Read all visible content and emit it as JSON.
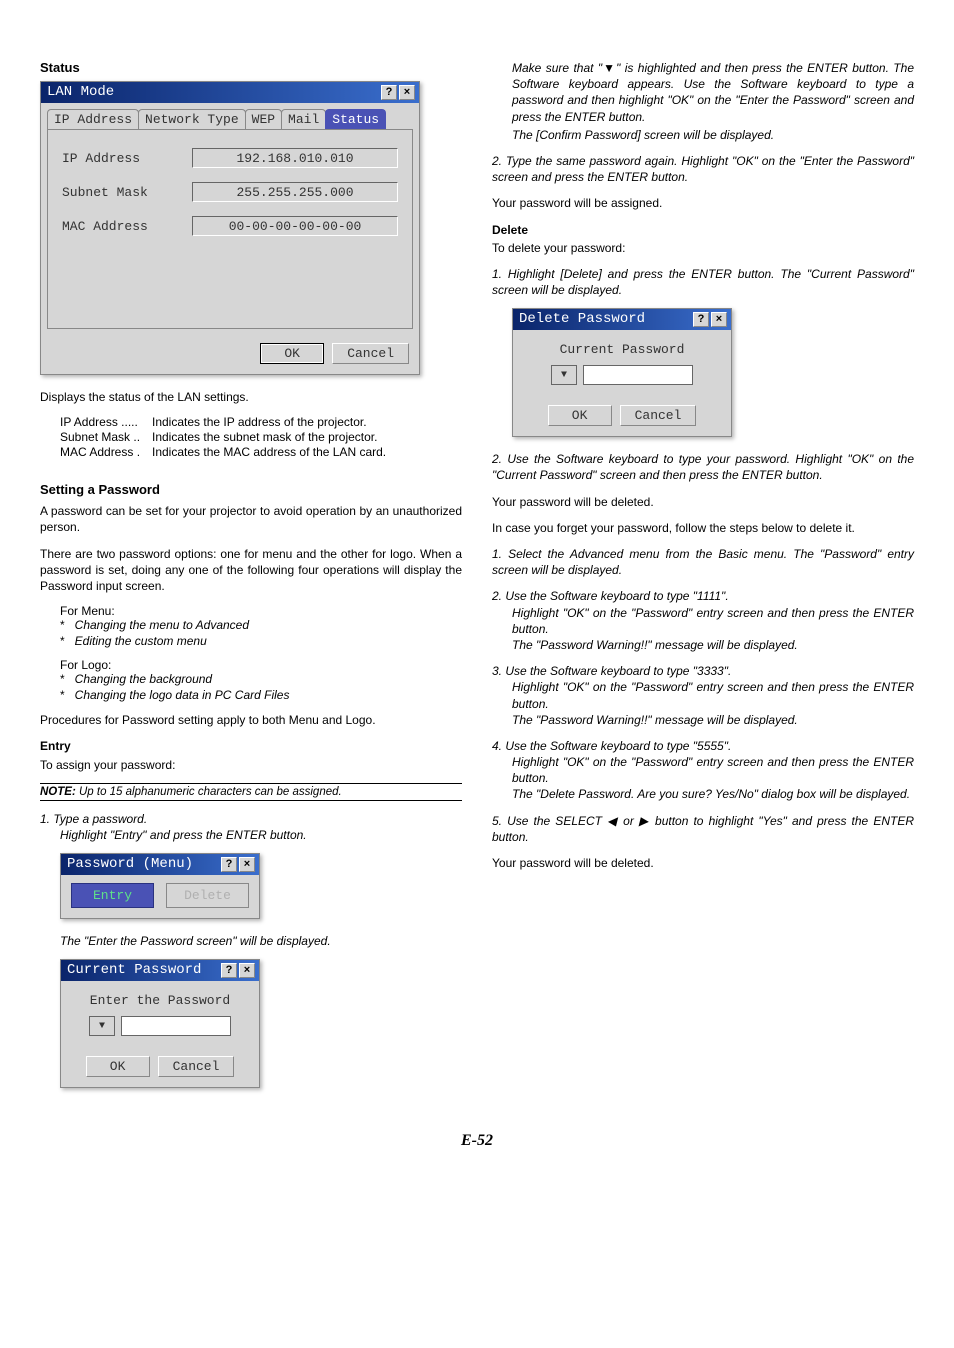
{
  "page_number": "E-52",
  "left": {
    "status_heading": "Status",
    "lan_dialog": {
      "title": "LAN Mode",
      "help_btn": "?",
      "close_btn": "×",
      "tabs": [
        "IP Address",
        "Network Type",
        "WEP",
        "Mail",
        "Status"
      ],
      "active_tab": "Status",
      "fields": {
        "ip_label": "IP Address",
        "ip_value": "192.168.010.010",
        "subnet_label": "Subnet Mask",
        "subnet_value": "255.255.255.000",
        "mac_label": "MAC Address",
        "mac_value": "00-00-00-00-00-00"
      },
      "ok": "OK",
      "cancel": "Cancel"
    },
    "status_desc": "Displays the status of the LAN settings.",
    "dl": [
      {
        "term": "IP Address",
        "dots": ".....",
        "def": "Indicates the IP address of the projector."
      },
      {
        "term": "Subnet Mask",
        "dots": "..",
        "def": "Indicates the subnet mask of the projector."
      },
      {
        "term": "MAC Address",
        "dots": ".",
        "def": "Indicates the MAC address of the LAN card."
      }
    ],
    "setting_heading": "Setting a Password",
    "setting_p1": "A password can be set for your projector to avoid operation by an unauthorized person.",
    "setting_p2": "There are two password options: one for menu and the other for logo. When a password is set, doing any one of the following four operations will display the Password input screen.",
    "for_menu": "For Menu:",
    "menu_bullets": [
      "Changing the menu to Advanced",
      "Editing the custom menu"
    ],
    "for_logo": "For Logo:",
    "logo_bullets": [
      "Changing the background",
      "Changing the logo data in PC Card Files"
    ],
    "procedures_p": "Procedures for Password setting apply to both Menu and Logo.",
    "entry_heading": "Entry",
    "entry_intro": "To assign your password:",
    "note_label": "NOTE:",
    "note_text": " Up to 15 alphanumeric characters can be assigned.",
    "step1_a": "1. Type a password.",
    "step1_b": "Highlight \"Entry\" and press the ENTER button.",
    "pwd_menu_dialog": {
      "title": "Password (Menu)",
      "entry": "Entry",
      "delete": "Delete"
    },
    "enter_pwd_displayed": "The \"Enter the Password screen\" will be displayed.",
    "current_pwd_dialog": {
      "title": "Current Password",
      "label": "Enter the Password",
      "ok": "OK",
      "cancel": "Cancel"
    }
  },
  "right": {
    "cont1a": "Make sure that \"▼\" is highlighted and then press the ENTER button. The Software keyboard appears. Use the Software keyboard to type a password and then highlight \"OK\" on the \"Enter the Password\" screen and press the ENTER button.",
    "cont1b": "The [Confirm Password] screen will be displayed.",
    "step2": "2. Type the same password again. Highlight \"OK\" on the \"Enter the Password\" screen and press the ENTER button.",
    "assigned": "Your password will be assigned.",
    "delete_heading": "Delete",
    "delete_intro": "To delete your password:",
    "d_step1": "1. Highlight [Delete] and press the ENTER button. The \"Current Password\" screen will be displayed.",
    "delete_dialog": {
      "title": "Delete Password",
      "label": "Current Password",
      "ok": "OK",
      "cancel": "Cancel"
    },
    "d_step2": "2. Use the Software keyboard to type your password. Highlight \"OK\" on the \"Current Password\" screen and then press the ENTER button.",
    "deleted": "Your password will be deleted.",
    "forget_intro": "In case you forget your password, follow the steps below to delete it.",
    "f1": "1. Select the Advanced menu from the Basic menu. The \"Password\" entry screen will be displayed.",
    "f2a": "2. Use the Software keyboard to type \"1111\".",
    "f2b": "Highlight \"OK\" on the \"Password\" entry screen and then press the ENTER button.",
    "f2c": "The \"Password Warning!!\" message will be displayed.",
    "f3a": "3. Use the Software keyboard to type \"3333\".",
    "f3b": "Highlight \"OK\" on the \"Password\" entry screen and then press the ENTER button.",
    "f3c": "The \"Password Warning!!\" message will be displayed.",
    "f4a": "4. Use the Software keyboard to type \"5555\".",
    "f4b": "Highlight \"OK\" on the \"Password\" entry screen and then press the ENTER button.",
    "f4c": "The \"Delete Password. Are you sure? Yes/No\" dialog box will be displayed.",
    "f5": "5. Use the SELECT ◀ or ▶ button to highlight \"Yes\" and press the ENTER button.",
    "deleted2": "Your password will be deleted."
  }
}
